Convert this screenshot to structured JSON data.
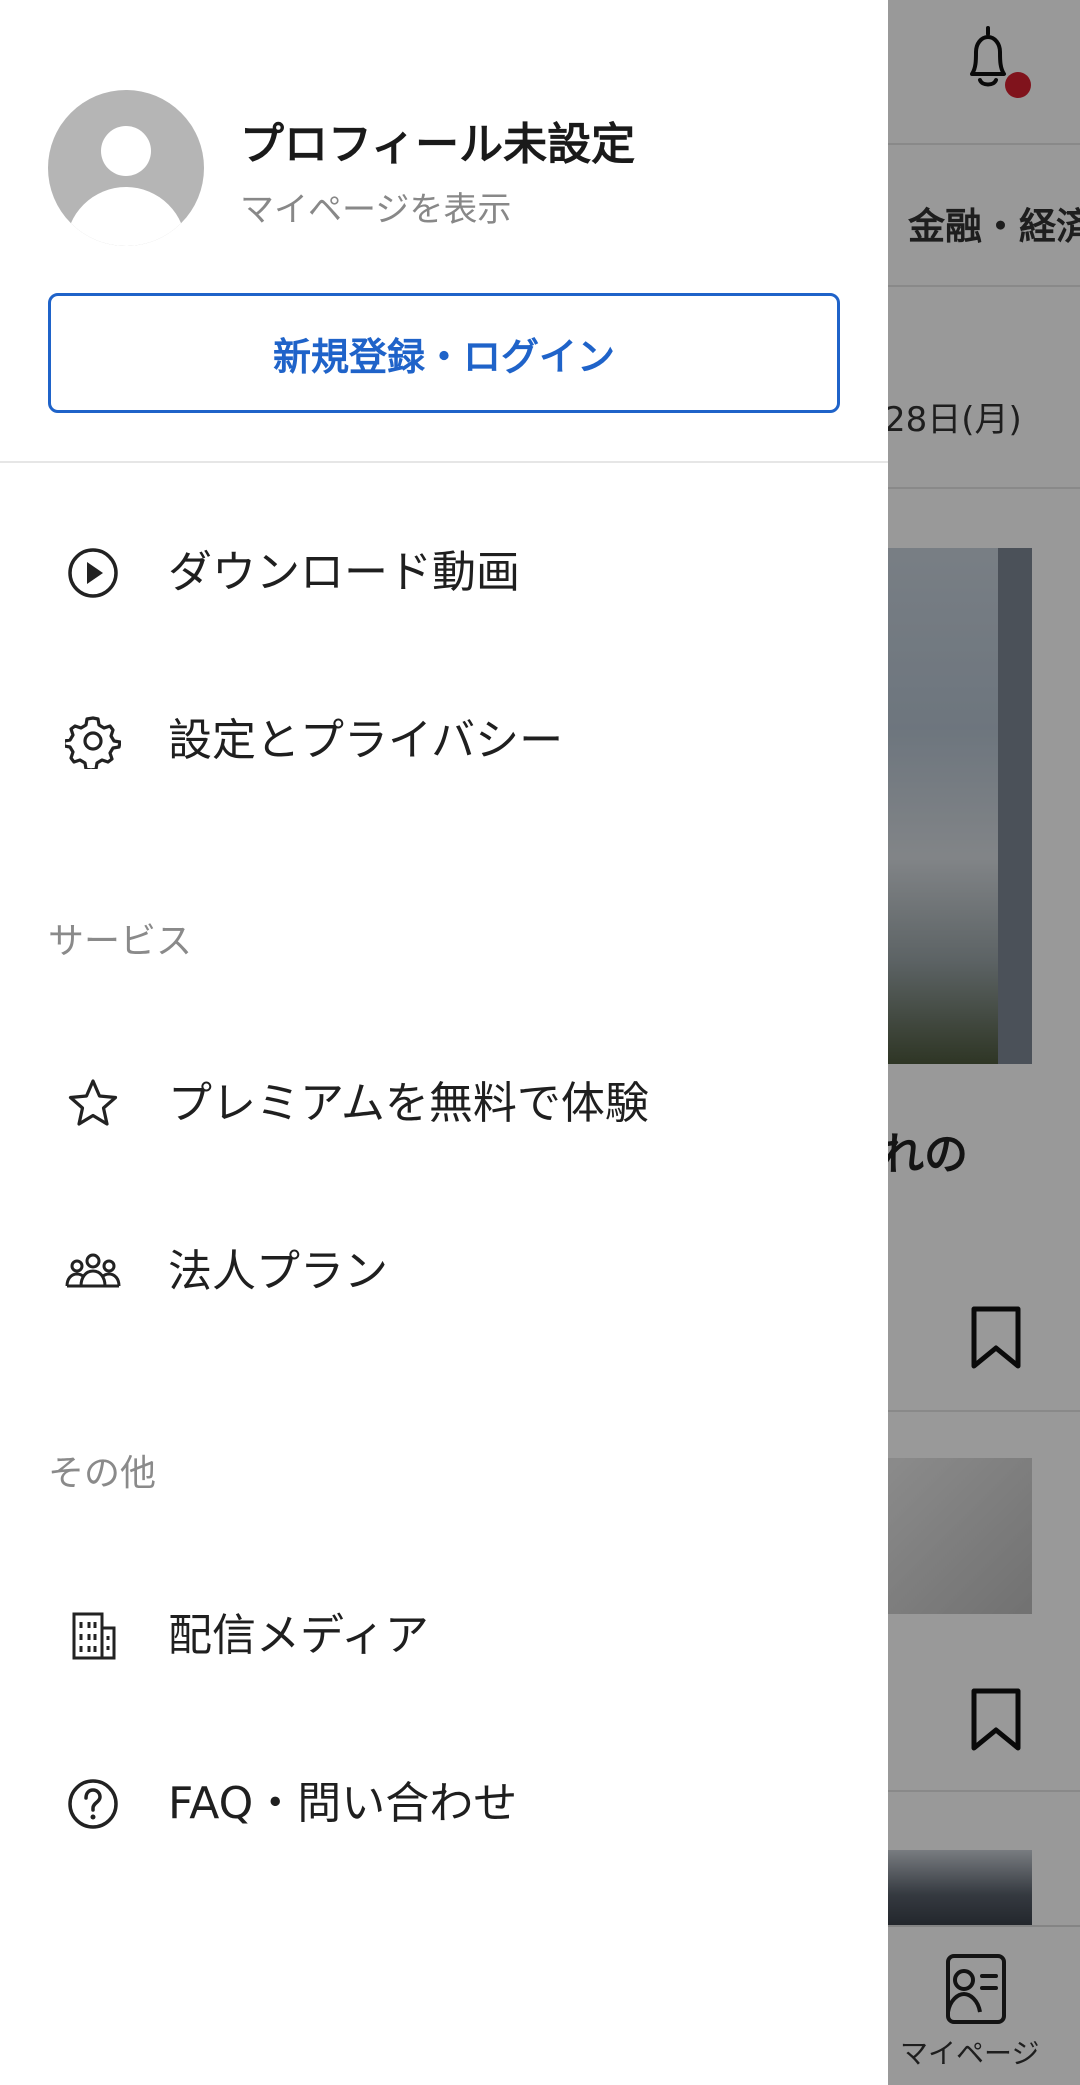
{
  "background": {
    "category_tab": "金融・経済",
    "date_partial": "28日(月)",
    "headline_partial": "れの",
    "bottom_nav_label": "マイページ",
    "notification_dot_color": "#d6202f",
    "icons": [
      "bell-icon",
      "bookmark-icon",
      "mypage-icon"
    ]
  },
  "drawer": {
    "profile": {
      "name": "プロフィール未設定",
      "subtitle": "マイページを表示"
    },
    "login_button": "新規登録・ログイン",
    "accent_color": "#1f63c9",
    "menu": [
      {
        "icon": "play-circle-icon",
        "label": "ダウンロード動画"
      },
      {
        "icon": "gear-icon",
        "label": "設定とプライバシー"
      }
    ],
    "sections": [
      {
        "title": "サービス",
        "items": [
          {
            "icon": "star-icon",
            "label": "プレミアムを無料で体験"
          },
          {
            "icon": "group-icon",
            "label": "法人プラン"
          }
        ]
      },
      {
        "title": "その他",
        "items": [
          {
            "icon": "building-icon",
            "label": "配信メディア"
          },
          {
            "icon": "help-circle-icon",
            "label": "FAQ・問い合わせ"
          }
        ]
      }
    ]
  }
}
